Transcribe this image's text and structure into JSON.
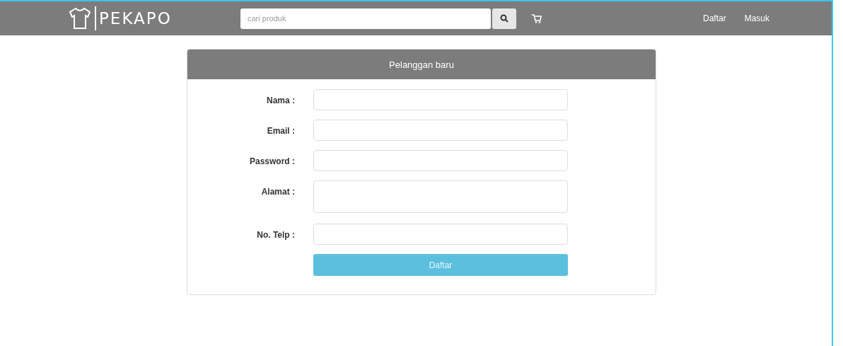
{
  "navbar": {
    "brand": "PEKAPO",
    "search": {
      "placeholder": "cari produk"
    },
    "links": [
      "Daftar",
      "Masuk"
    ]
  },
  "form": {
    "title": "Pelanggan baru",
    "fields": [
      {
        "label": "Nama :",
        "kind": "input"
      },
      {
        "label": "Email :",
        "kind": "input"
      },
      {
        "label": "Password :",
        "kind": "input"
      },
      {
        "label": "Alamat :",
        "kind": "textarea"
      },
      {
        "label": "No. Telp :",
        "kind": "input"
      }
    ],
    "submit": "Daftar"
  }
}
